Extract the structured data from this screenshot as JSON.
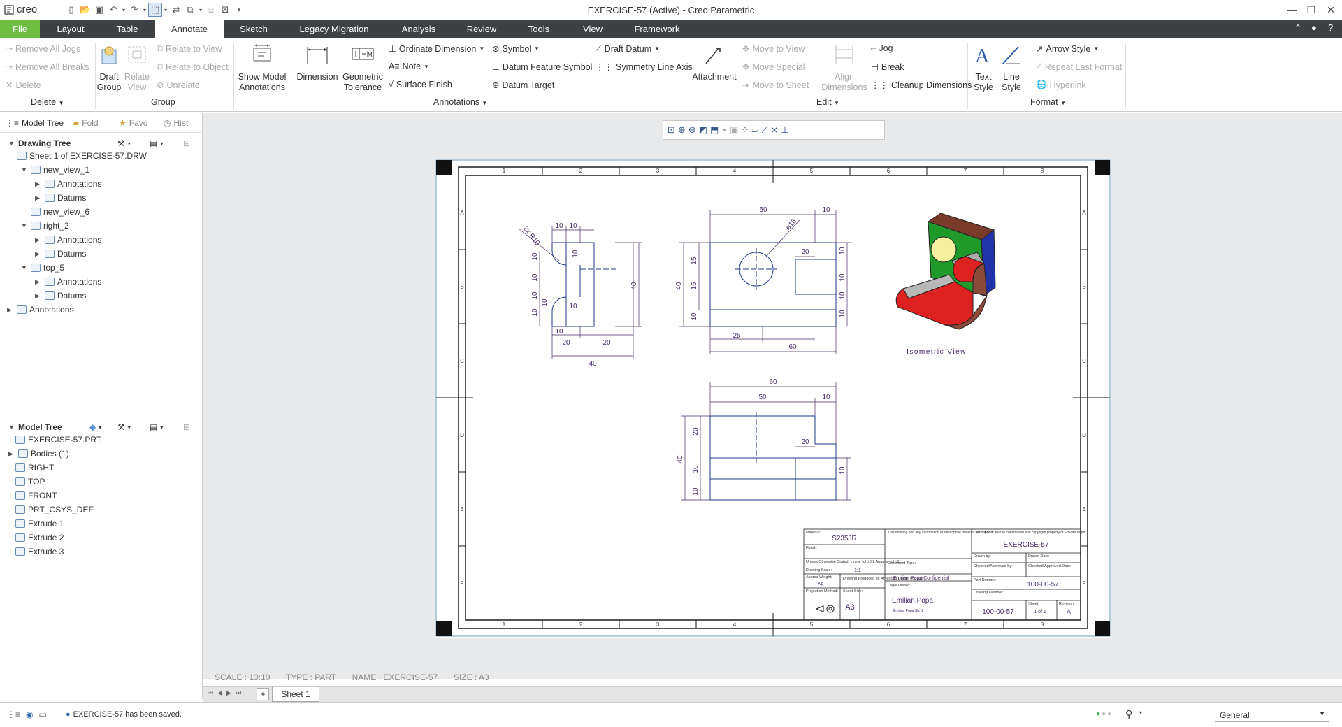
{
  "app": {
    "logo": "creo",
    "window_title": "EXERCISE-57 (Active) - Creo Parametric"
  },
  "menu": {
    "tabs": [
      "File",
      "Layout",
      "Table",
      "Annotate",
      "Sketch",
      "Legacy Migration",
      "Analysis",
      "Review",
      "Tools",
      "View",
      "Framework"
    ],
    "active": "Annotate"
  },
  "ribbon": {
    "delete_group": {
      "remove_all_jogs": "Remove All Jogs",
      "remove_all_breaks": "Remove All Breaks",
      "delete": "Delete",
      "label": "Delete"
    },
    "group_group": {
      "draft_group": "Draft\nGroup",
      "relate_view": "Relate\nView",
      "relate_to_view": "Relate to View",
      "relate_to_object": "Relate to Object",
      "unrelate": "Unrelate",
      "label": "Group"
    },
    "annotations_group": {
      "show_model_annotations": "Show Model\nAnnotations",
      "dimension": "Dimension",
      "geometric_tolerance": "Geometric\nTolerance",
      "ordinate_dimension": "Ordinate Dimension",
      "note": "Note",
      "surface_finish": "Surface Finish",
      "symbol": "Symbol",
      "datum_feature_symbol": "Datum Feature Symbol",
      "datum_target": "Datum Target",
      "draft_datum": "Draft Datum",
      "symmetry_line_axis": "Symmetry Line Axis",
      "label": "Annotations"
    },
    "edit_group": {
      "attachment": "Attachment",
      "move_to_view": "Move to View",
      "move_special": "Move Special",
      "move_to_sheet": "Move to Sheet",
      "align_dimensions": "Align\nDimensions",
      "jog": "Jog",
      "break": "Break",
      "cleanup_dimensions": "Cleanup Dimensions",
      "label": "Edit"
    },
    "format_group": {
      "text_style": "Text\nStyle",
      "line_style": "Line\nStyle",
      "arrow_style": "Arrow Style",
      "repeat_last_format": "Repeat Last Format",
      "hyperlink": "Hyperlink",
      "label": "Format"
    }
  },
  "left_panel": {
    "tabs": [
      "Model Tree",
      "Fold",
      "Favo",
      "Hist"
    ],
    "drawing_tree_title": "Drawing Tree",
    "drawing_tree": [
      {
        "label": "Sheet 1 of EXERCISE-57.DRW",
        "level": 0,
        "expander": ""
      },
      {
        "label": "new_view_1",
        "level": 1,
        "expander": "▼"
      },
      {
        "label": "Annotations",
        "level": 2,
        "expander": "▶"
      },
      {
        "label": "Datums",
        "level": 2,
        "expander": "▶"
      },
      {
        "label": "new_view_6",
        "level": 1,
        "expander": ""
      },
      {
        "label": "right_2",
        "level": 1,
        "expander": "▼"
      },
      {
        "label": "Annotations",
        "level": 2,
        "expander": "▶"
      },
      {
        "label": "Datums",
        "level": 2,
        "expander": "▶"
      },
      {
        "label": "top_5",
        "level": 1,
        "expander": "▼"
      },
      {
        "label": "Annotations",
        "level": 2,
        "expander": "▶"
      },
      {
        "label": "Datums",
        "level": 2,
        "expander": "▶"
      },
      {
        "label": "Annotations",
        "level": 0,
        "expander": "▶"
      }
    ],
    "model_tree_title": "Model Tree",
    "model_tree": [
      {
        "label": "EXERCISE-57.PRT",
        "expander": ""
      },
      {
        "label": "Bodies (1)",
        "expander": "▶"
      },
      {
        "label": "RIGHT",
        "expander": ""
      },
      {
        "label": "TOP",
        "expander": ""
      },
      {
        "label": "FRONT",
        "expander": ""
      },
      {
        "label": "PRT_CSYS_DEF",
        "expander": ""
      },
      {
        "label": "Extrude 1",
        "expander": ""
      },
      {
        "label": "Extrude 2",
        "expander": ""
      },
      {
        "label": "Extrude 3",
        "expander": ""
      }
    ]
  },
  "drawing": {
    "zone_cols": [
      "1",
      "2",
      "3",
      "4",
      "5",
      "6",
      "7",
      "8"
    ],
    "zone_rows": [
      "A",
      "B",
      "C",
      "D",
      "E",
      "F"
    ],
    "view_left_dims": [
      "10",
      "10",
      "10",
      "10",
      "10",
      "10",
      "10",
      "10",
      "10",
      "10",
      "20",
      "20",
      "40",
      "40",
      "2x R10"
    ],
    "view_front_dims": [
      "50",
      "10",
      "ø16",
      "20",
      "10",
      "10",
      "10",
      "10",
      "15",
      "15",
      "40",
      "10",
      "25",
      "60"
    ],
    "view_top_dims": [
      "60",
      "50",
      "10",
      "20",
      "20",
      "10",
      "10",
      "40",
      "10"
    ],
    "iso_label": "Isometric View",
    "title_block": {
      "material_label": "Material:",
      "material": "S235JR",
      "finish_label": "Finish:",
      "tolerances": "Unless Otherwise Stated:\nLinear tol ±0.2 Angular tol ±1°",
      "drawing_scale_label": "Drawing Scale:",
      "drawing_scale": "1:1",
      "approx_weight_label": "Approx Weight:",
      "approx_weight": "Kg",
      "drawing_produced": "Drawing Produced to:\nAmerican Union: 005838",
      "projection_label": "Projection Method:",
      "sheet_size_label": "Sheet Size:",
      "sheet_size": "A3",
      "copyright": "This drawing and any information or descriptive material set out on it are the confidential and copyright property of Emilian Popa.",
      "document_type_label": "Document Type:",
      "confidential": "Emilian Popa Confidential",
      "legal_owner_label": "Legal Owner:",
      "legal_owner": "Emilian Popa",
      "address": "Emilian Popa Str. 1",
      "description_label": "Description:",
      "description": "EXERCISE-57",
      "drawn_by_label": "Drawn by:",
      "drawn_date_label": "Drawn Date:",
      "checked_label": "Checked/Approved by:",
      "checked_date_label": "Checked/Approved Date:",
      "part_number_label": "Part Number:",
      "part_number": "100-00-57",
      "drawing_number_label": "Drawing Number:",
      "drawing_number": "100-00-57",
      "sheet_label": "Sheet:",
      "sheet": "1 of 1",
      "revision_label": "Revision:",
      "revision": "A"
    }
  },
  "status_info": {
    "scale": "SCALE : 13:10",
    "type": "TYPE : PART",
    "name": "NAME : EXERCISE-57",
    "size": "SIZE : A3"
  },
  "sheet_tabs": [
    "Sheet 1"
  ],
  "bottom": {
    "message": "EXERCISE-57 has been saved.",
    "filter": "General"
  },
  "colors": {
    "accent_green": "#6ebe44",
    "menubar": "#3d4144",
    "dim_purple": "#4a2a6a",
    "geom_blue": "#1e3a8a"
  }
}
